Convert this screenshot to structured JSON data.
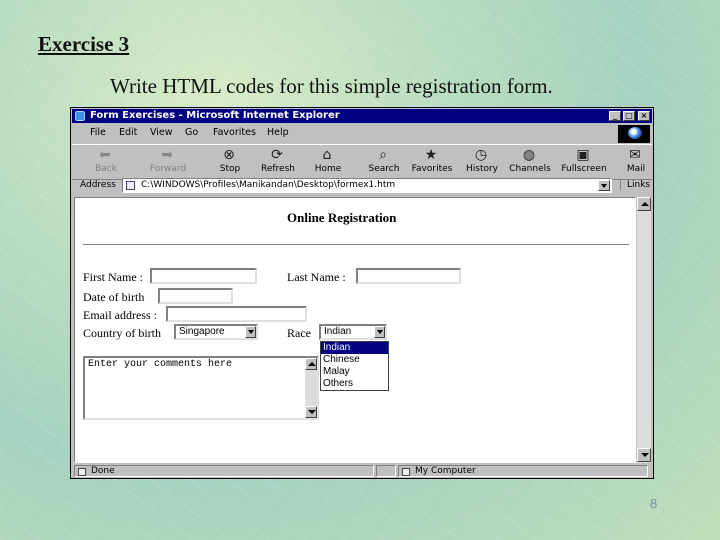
{
  "slide": {
    "title": "Exercise 3",
    "subtitle": "Write HTML codes for this simple registration form.",
    "page_number": "8"
  },
  "window": {
    "title": "Form Exercises - Microsoft Internet Explorer",
    "menu": [
      "File",
      "Edit",
      "View",
      "Go",
      "Favorites",
      "Help"
    ],
    "toolbar": [
      {
        "label": "Back",
        "icon": "back-arrow-icon"
      },
      {
        "label": "Forward",
        "icon": "forward-arrow-icon"
      },
      {
        "label": "Stop",
        "icon": "stop-icon"
      },
      {
        "label": "Refresh",
        "icon": "refresh-icon"
      },
      {
        "label": "Home",
        "icon": "home-icon"
      },
      {
        "label": "Search",
        "icon": "search-icon"
      },
      {
        "label": "Favorites",
        "icon": "favorites-icon"
      },
      {
        "label": "History",
        "icon": "history-icon"
      },
      {
        "label": "Channels",
        "icon": "channels-icon"
      },
      {
        "label": "Fullscreen",
        "icon": "fullscreen-icon"
      },
      {
        "label": "Mail",
        "icon": "mail-icon"
      }
    ],
    "address_label": "Address",
    "address": "C:\\WINDOWS\\Profiles\\Manikandan\\Desktop\\formex1.htm",
    "links_label": "Links",
    "status": "Done",
    "zone": "My Computer"
  },
  "form": {
    "heading": "Online Registration",
    "first_name_label": "First Name :",
    "last_name_label": "Last Name :",
    "dob_label": "Date of birth",
    "email_label": "Email address :",
    "country_label": "Country of birth",
    "country_value": "Singapore",
    "race_label": "Race",
    "race_value": "Indian",
    "race_options": [
      "Indian",
      "Chinese",
      "Malay",
      "Others"
    ],
    "comments_placeholder": "Enter your comments here"
  }
}
